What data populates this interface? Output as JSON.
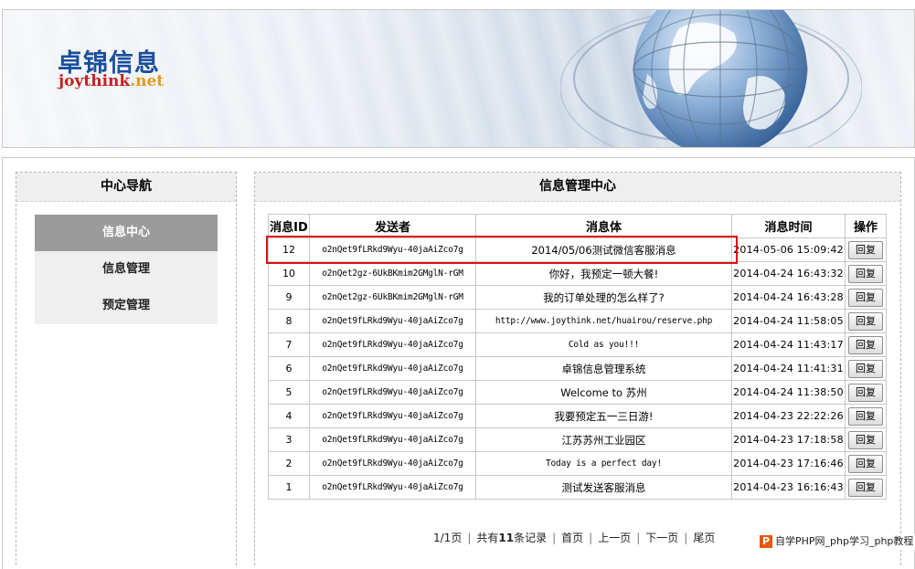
{
  "header": {
    "logo_cn": "卓锦信息",
    "logo_en_main": "joythink",
    "logo_en_suffix": ".net"
  },
  "nav": {
    "title": "中心导航",
    "items": [
      {
        "label": "信息中心",
        "active": true
      },
      {
        "label": "信息管理",
        "active": false
      },
      {
        "label": "预定管理",
        "active": false
      }
    ]
  },
  "main": {
    "title": "信息管理中心",
    "columns": [
      "消息ID",
      "发送者",
      "消息体",
      "消息时间",
      "操作"
    ],
    "reply_label": "回复",
    "rows": [
      {
        "id": "12",
        "sender": "o2nQet9fLRkd9Wyu-40jaAiZco7g",
        "body": "2014/05/06测试微信客服消息",
        "time": "2014-05-06 15:09:42"
      },
      {
        "id": "10",
        "sender": "o2nQet2gz-6UkBKmim2GMglN-rGM",
        "body": "你好，我预定一顿大餐!",
        "time": "2014-04-24 16:43:32"
      },
      {
        "id": "9",
        "sender": "o2nQet2gz-6UkBKmim2GMglN-rGM",
        "body": "我的订单处理的怎么样了?",
        "time": "2014-04-24 16:43:28"
      },
      {
        "id": "8",
        "sender": "o2nQet9fLRkd9Wyu-40jaAiZco7g",
        "body": "http://www.joythink.net/huairou/reserve.php",
        "time": "2014-04-24 11:58:05"
      },
      {
        "id": "7",
        "sender": "o2nQet9fLRkd9Wyu-40jaAiZco7g",
        "body": "Cold as you!!!",
        "time": "2014-04-24 11:43:17"
      },
      {
        "id": "6",
        "sender": "o2nQet9fLRkd9Wyu-40jaAiZco7g",
        "body": "卓锦信息管理系统",
        "time": "2014-04-24 11:41:31"
      },
      {
        "id": "5",
        "sender": "o2nQet9fLRkd9Wyu-40jaAiZco7g",
        "body": "Welcome to 苏州",
        "time": "2014-04-24 11:38:50"
      },
      {
        "id": "4",
        "sender": "o2nQet9fLRkd9Wyu-40jaAiZco7g",
        "body": "我要预定五一三日游!",
        "time": "2014-04-23 22:22:26"
      },
      {
        "id": "3",
        "sender": "o2nQet9fLRkd9Wyu-40jaAiZco7g",
        "body": "江苏苏州工业园区",
        "time": "2014-04-23 17:18:58"
      },
      {
        "id": "2",
        "sender": "o2nQet9fLRkd9Wyu-40jaAiZco7g",
        "body": "Today is a perfect day!",
        "time": "2014-04-23 17:16:46"
      },
      {
        "id": "1",
        "sender": "o2nQet9fLRkd9Wyu-40jaAiZco7g",
        "body": "测试发送客服消息",
        "time": "2014-04-23 16:16:43"
      }
    ]
  },
  "pager": {
    "page_info": "1/1页",
    "total_prefix": "共有",
    "total_count": "11",
    "total_suffix": "条记录",
    "first": "首页",
    "prev": "上一页",
    "next": "下一页",
    "last": "尾页"
  },
  "watermark": {
    "icon_letter": "P",
    "text": "自学PHP网_php学习_php教程"
  }
}
